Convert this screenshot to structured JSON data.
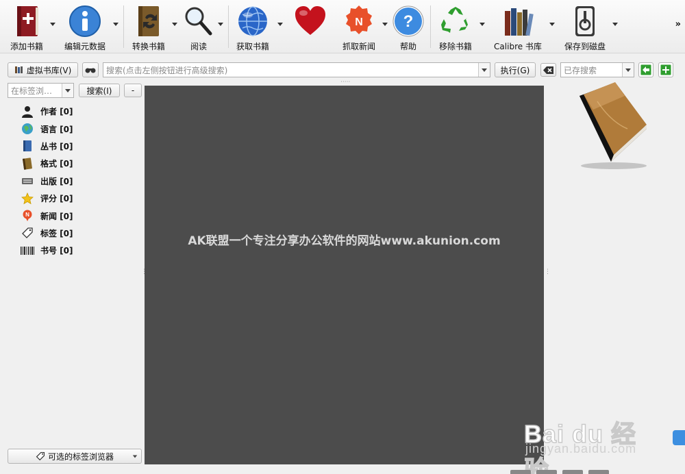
{
  "toolbar": {
    "add_books": "添加书籍",
    "edit_metadata": "编辑元数据",
    "convert_books": "转换书籍",
    "view": "阅读",
    "get_books": "获取书籍",
    "fetch_news": "抓取新闻",
    "help": "帮助",
    "remove_books": "移除书籍",
    "calibre_library": "Calibre 书库",
    "save_to_disk": "保存到磁盘",
    "more": "»"
  },
  "search_bar": {
    "virtual_library": "虚拟书库(V)",
    "search_placeholder": "搜索(点击左侧按钮进行高级搜索)",
    "go_button": "执行(G)",
    "saved_search_placeholder": "已存搜索"
  },
  "tag_browser": {
    "filter_placeholder": "在标签浏…",
    "find_button": "搜索(I)",
    "collapse_button": "-",
    "items": [
      {
        "label": "作者 [0]",
        "icon": "user-icon"
      },
      {
        "label": "语言 [0]",
        "icon": "globe-language-icon"
      },
      {
        "label": "丛书 [0]",
        "icon": "series-book-icon"
      },
      {
        "label": "格式 [0]",
        "icon": "format-book-icon"
      },
      {
        "label": "出版 [0]",
        "icon": "publisher-icon"
      },
      {
        "label": "评分 [0]",
        "icon": "star-icon"
      },
      {
        "label": "新闻 [0]",
        "icon": "news-icon"
      },
      {
        "label": "标签 [0]",
        "icon": "tag-icon"
      },
      {
        "label": "书号 [0]",
        "icon": "barcode-icon"
      }
    ],
    "alter_browser_button": "可选的标签浏览器"
  },
  "library_area": {
    "overlay_text": "AK联盟一个专注分享办公软件的网站www.akunion.com"
  },
  "watermark": {
    "brand": "Bai du 经验",
    "url": "jingyan.baidu.com"
  },
  "colors": {
    "library_bg": "#4c4c4c",
    "window_bg": "#f0f0f0",
    "accent_green": "#2f9e2f"
  }
}
